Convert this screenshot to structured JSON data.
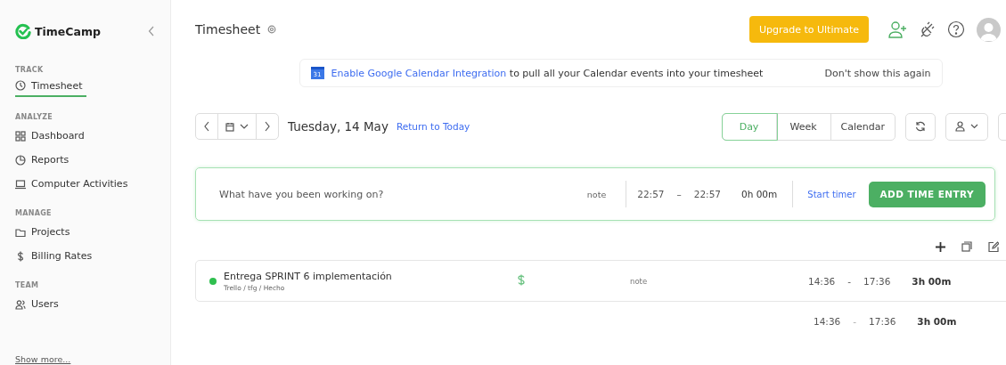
{
  "sidebar": {
    "logo": "TimeCamp",
    "sections": [
      {
        "heading": "TRACK",
        "items": [
          {
            "label": "Timesheet",
            "selected": true
          }
        ]
      },
      {
        "heading": "ANALYZE",
        "items": [
          {
            "label": "Dashboard",
            "selected": false
          },
          {
            "label": "Reports",
            "selected": false
          },
          {
            "label": "Computer Activities",
            "selected": false
          }
        ]
      },
      {
        "heading": "MANAGE",
        "items": [
          {
            "label": "Projects",
            "selected": false
          },
          {
            "label": "Billing Rates",
            "selected": false
          }
        ]
      },
      {
        "heading": "TEAM",
        "items": [
          {
            "label": "Users",
            "selected": false
          }
        ]
      }
    ],
    "show_more": "Show more..."
  },
  "header": {
    "title": "Timesheet",
    "upgrade_button": "Upgrade to Ultimate"
  },
  "banner": {
    "calendar_icon_text": "31",
    "link": "Enable Google Calendar Integration",
    "text": "to pull all your Calendar events into your timesheet",
    "dismiss": "Don't show this again"
  },
  "date_bar": {
    "date": "Tuesday, 14 May",
    "return_link": "Return to Today",
    "views": [
      {
        "label": "Day",
        "selected": true
      },
      {
        "label": "Week",
        "selected": false
      },
      {
        "label": "Calendar",
        "selected": false
      }
    ]
  },
  "entry_form": {
    "placeholder": "What have you been working on?",
    "note": "note",
    "start": "22:57",
    "separator": "–",
    "end": "22:57",
    "duration": "0h 00m",
    "start_timer": "Start timer",
    "add_button": "ADD TIME ENTRY"
  },
  "entries": [
    {
      "title": "Entrega SPRINT 6 implementación",
      "path": "Trello / tfg / Hecho",
      "color": "#2fbf4f",
      "billable": true,
      "note": "note",
      "start": "14:36",
      "separator": "-",
      "end": "17:36",
      "duration": "3h 00m"
    }
  ],
  "total": {
    "start": "14:36",
    "separator": "-",
    "end": "17:36",
    "duration": "3h 00m"
  }
}
